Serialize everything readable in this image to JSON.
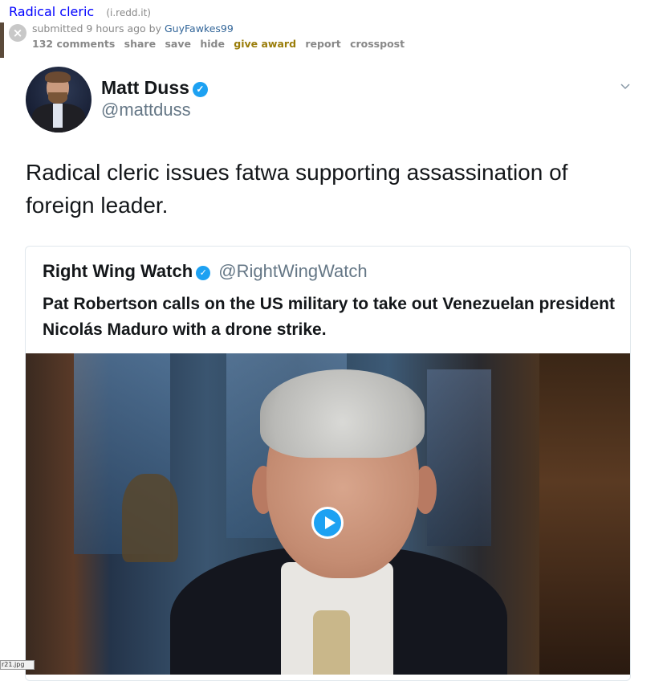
{
  "post": {
    "title": "Radical cleric",
    "domain": "(i.redd.it)",
    "tagline_prefix": "submitted 9 hours ago by",
    "author": "GuyFawkes99",
    "hide_icon": "close-circle-icon",
    "buttons": {
      "comments": "132 comments",
      "share": "share",
      "save": "save",
      "hide": "hide",
      "give_award": "give award",
      "report": "report",
      "crosspost": "crosspost"
    }
  },
  "tweet": {
    "display_name": "Matt Duss",
    "handle": "@mattduss",
    "text": "Radical cleric issues fatwa supporting assassination of foreign leader.",
    "verified_icon": "verified-badge-icon",
    "menu_icon": "chevron-down-icon"
  },
  "quoted_tweet": {
    "display_name": "Right Wing Watch",
    "handle": "@RightWingWatch",
    "text": "Pat Robertson calls on the US military to take out Venezuelan president Nicolás Maduro with a drone strike.",
    "media_icon": "play-icon"
  },
  "colors": {
    "link": "#0000ff",
    "twitter_blue": "#1da1f2",
    "award": "#9a7d0a"
  },
  "file_label": "r21.jpg"
}
